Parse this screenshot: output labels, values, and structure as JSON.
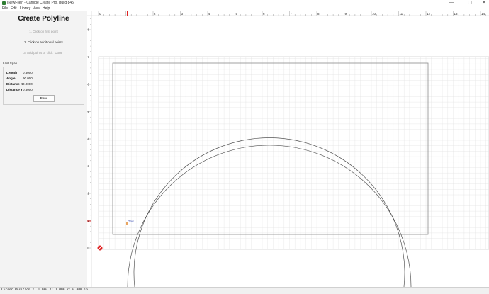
{
  "window": {
    "title": "[NewFile]* - Carbide Create Pro, Build 845",
    "minimize": "—",
    "maximize": "▢",
    "close": "✕"
  },
  "menu": [
    "File",
    "Edit",
    "Library",
    "View",
    "Help"
  ],
  "panel": {
    "title": "Create Polyline",
    "steps": [
      {
        "text": "1. Click on first point",
        "active": false
      },
      {
        "text": "2. Click on additional points",
        "active": true
      },
      {
        "text": "3. Add points or click \"Done\"",
        "active": false
      }
    ],
    "last_span_label": "Last Span",
    "fields": [
      {
        "label": "Length",
        "value": "0.5000"
      },
      {
        "label": "Angle",
        "value": "90.000"
      },
      {
        "label": "Distance X",
        "value": "0.0000"
      },
      {
        "label": "Distance Y",
        "value": "0.5000"
      }
    ],
    "done_label": "Done"
  },
  "rulers": {
    "top_labels": [
      "0",
      "1",
      "2",
      "3",
      "4",
      "5",
      "6",
      "7",
      "8",
      "9",
      "10",
      "11",
      "12",
      "13",
      "14"
    ],
    "left_labels": [
      "0",
      "1",
      "2",
      "3",
      "4",
      "5",
      "6",
      "7",
      "8"
    ]
  },
  "canvas": {
    "snap_label": "Grid"
  },
  "status": {
    "cursor_position": "Cursor Position X: 1.000 Y: 1.000 Z: 0.000 in"
  },
  "colors": {
    "grid": "#e2e2e2",
    "stock": "#8c8c8c",
    "geometry": "#555555",
    "origin": "#e02020",
    "snap": "#2a3fb0"
  }
}
